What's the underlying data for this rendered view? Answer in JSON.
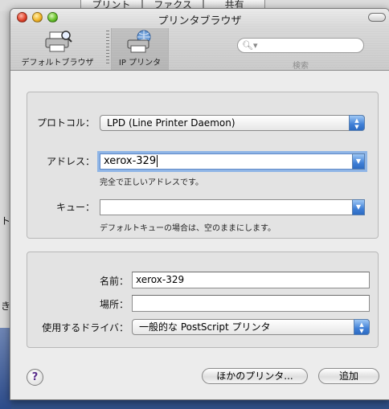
{
  "background_window": {
    "tabs": [
      "プリント",
      "ファクス",
      "共有"
    ],
    "left_fragments": [
      "ト",
      "き"
    ]
  },
  "window": {
    "title": "プリンタブラウザ"
  },
  "toolbar": {
    "default_browser_label": "デフォルトブラウザ",
    "ip_printer_label": "IP プリンタ",
    "search_placeholder": "",
    "search_label": "検索"
  },
  "connection": {
    "protocol_label": "プロトコル：",
    "protocol_value": "LPD (Line Printer Daemon)",
    "address_label": "アドレス：",
    "address_value": "xerox-329",
    "address_hint": "完全で正しいアドレスです。",
    "queue_label": "キュー：",
    "queue_value": "",
    "queue_hint": "デフォルトキューの場合は、空のままにします。"
  },
  "printer_info": {
    "name_label": "名前：",
    "name_value": "xerox-329",
    "location_label": "場所：",
    "location_value": "",
    "driver_label": "使用するドライバ：",
    "driver_value": "一般的な PostScript プリンタ"
  },
  "buttons": {
    "help": "?",
    "more_printers": "ほかのプリンタ...",
    "add": "追加"
  }
}
